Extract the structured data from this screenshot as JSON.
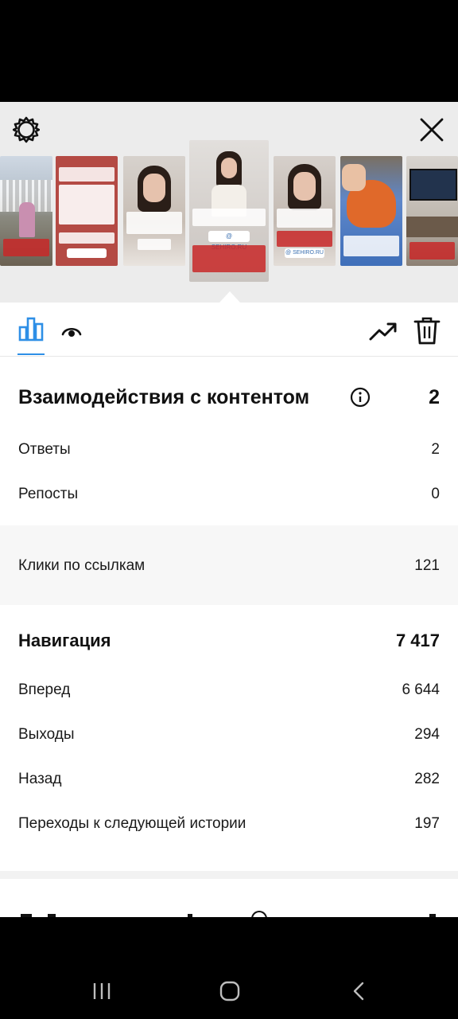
{
  "content_interactions": {
    "title": "Взаимодействия с контентом",
    "total": "2",
    "rows": [
      {
        "label": "Ответы",
        "value": "2"
      },
      {
        "label": "Репосты",
        "value": "0"
      },
      {
        "label": "Клики по ссылкам",
        "value": "121"
      }
    ]
  },
  "navigation": {
    "title": "Навигация",
    "total": "7 417",
    "rows": [
      {
        "label": "Вперед",
        "value": "6 644"
      },
      {
        "label": "Выходы",
        "value": "294"
      },
      {
        "label": "Назад",
        "value": "282"
      },
      {
        "label": "Переходы к следующей истории",
        "value": "197"
      }
    ]
  },
  "thumbnail_links": [
    "@ SEHIRO.RU",
    "@ SEHIRO.RU"
  ],
  "colors": {
    "accent": "#2e8fe6",
    "header_bg": "#ececec",
    "band_bg": "#f7f7f7"
  },
  "icons": {
    "settings": "gear-icon",
    "close": "close-icon",
    "insights_tab": "bar-chart-icon",
    "viewers_tab": "eye-icon",
    "promote": "trending-up-icon",
    "delete": "trash-icon",
    "info": "info-icon"
  }
}
